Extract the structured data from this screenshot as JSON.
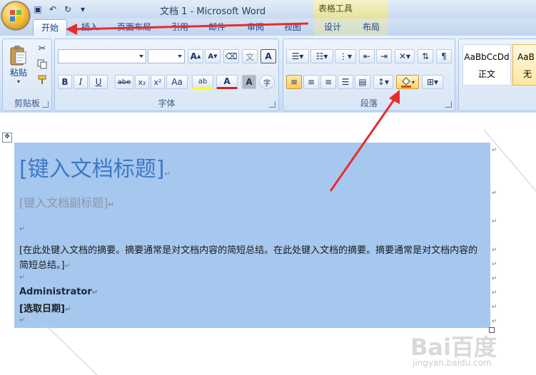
{
  "window": {
    "title": "文档 1 - Microsoft Word",
    "context_tab_group": "表格工具"
  },
  "quick_access": [
    {
      "icon": "save-icon",
      "glyph": "▣"
    },
    {
      "icon": "undo-icon",
      "glyph": "↶"
    },
    {
      "icon": "redo-icon",
      "glyph": "↻"
    },
    {
      "icon": "customize-qat-icon",
      "glyph": "▾"
    }
  ],
  "tabs": [
    {
      "label": "开始",
      "active": true
    },
    {
      "label": "插入"
    },
    {
      "label": "页面布局"
    },
    {
      "label": "引用"
    },
    {
      "label": "邮件"
    },
    {
      "label": "审阅"
    },
    {
      "label": "视图"
    },
    {
      "label": "设计"
    },
    {
      "label": "布局"
    }
  ],
  "ribbon": {
    "clipboard": {
      "label": "剪贴板",
      "paste_label": "粘贴",
      "cut_icon": "scissors-icon",
      "copy_icon": "copy-icon",
      "format_painter_icon": "format-painter-icon"
    },
    "font": {
      "label": "字体",
      "font_name_value": "",
      "font_size_value": "",
      "grow_label": "A",
      "shrink_label": "A",
      "bold": "B",
      "italic": "I",
      "underline": "U",
      "strikethrough": "abe",
      "subscript": "x₂",
      "superscript": "x²",
      "change_case": "Aa",
      "highlight_label": "ab",
      "font_color_label": "A",
      "char_shading_label": "A",
      "enclose_label": "字"
    },
    "paragraph": {
      "label": "段落",
      "shading_button_highlighted": true
    },
    "styles": {
      "style_1": "AaBbCcDd",
      "style_1_name": "正文",
      "style_2": "AaB",
      "style_2_name": "无"
    }
  },
  "document": {
    "title": "[键入文档标题]",
    "subtitle": "[键入文档副标题]",
    "abstract": "[在此处键入文档的摘要。摘要通常是对文档内容的简短总结。在此处键入文档的摘要。摘要通常是对文档内容的简短总结。]",
    "author": "Administrator",
    "date": "[选取日期]",
    "paragraph_mark": "↵"
  },
  "watermark": {
    "logo": "Bai百度",
    "sub": "jingyan.baidu.com"
  },
  "colors": {
    "selection": "#a6c8ef",
    "title_text": "#3f78c4",
    "arrow": "#e82c2c",
    "highlight_button": "#ffd36b"
  }
}
